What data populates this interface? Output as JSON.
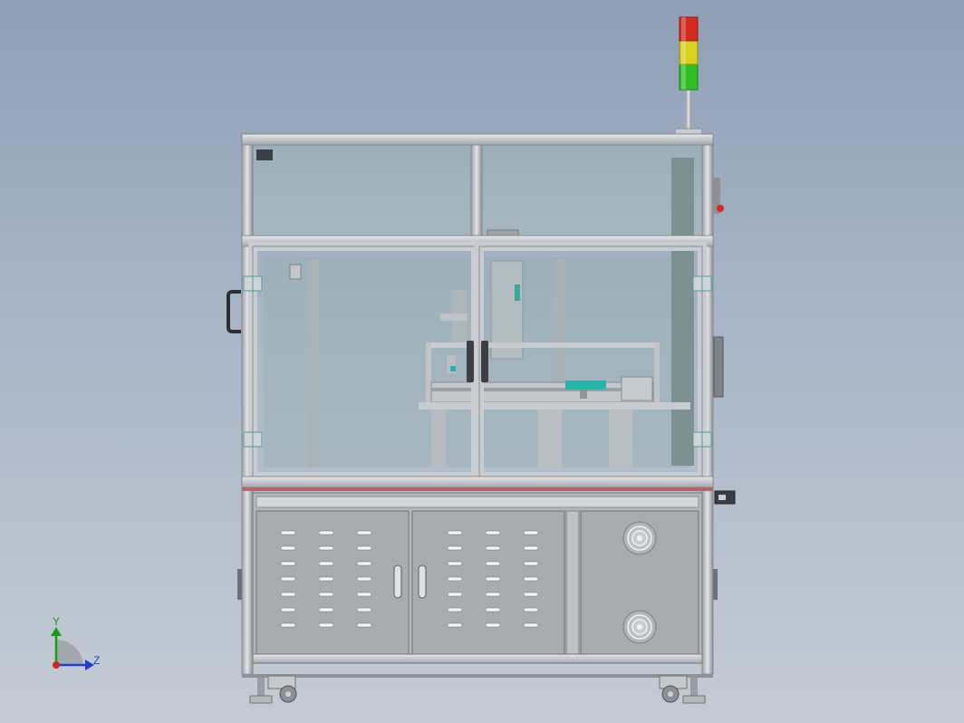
{
  "view": {
    "background_top": "#8f9fb6",
    "background_bottom": "#c4cbd4"
  },
  "signal_tower": {
    "lights": [
      "red",
      "yellow",
      "green"
    ],
    "colors": [
      "#d62a1f",
      "#d8d21c",
      "#2fbf22"
    ]
  },
  "triad": {
    "y_label": "Y",
    "z_label": "Z",
    "y_color": "#14a014",
    "z_color": "#1e3fd0"
  },
  "machine": {
    "frame_color": "#bfc3c8",
    "glass_color": "#9fb2bc",
    "cabinet_color": "#a9abad",
    "accent_color": "#2ab3a8"
  }
}
